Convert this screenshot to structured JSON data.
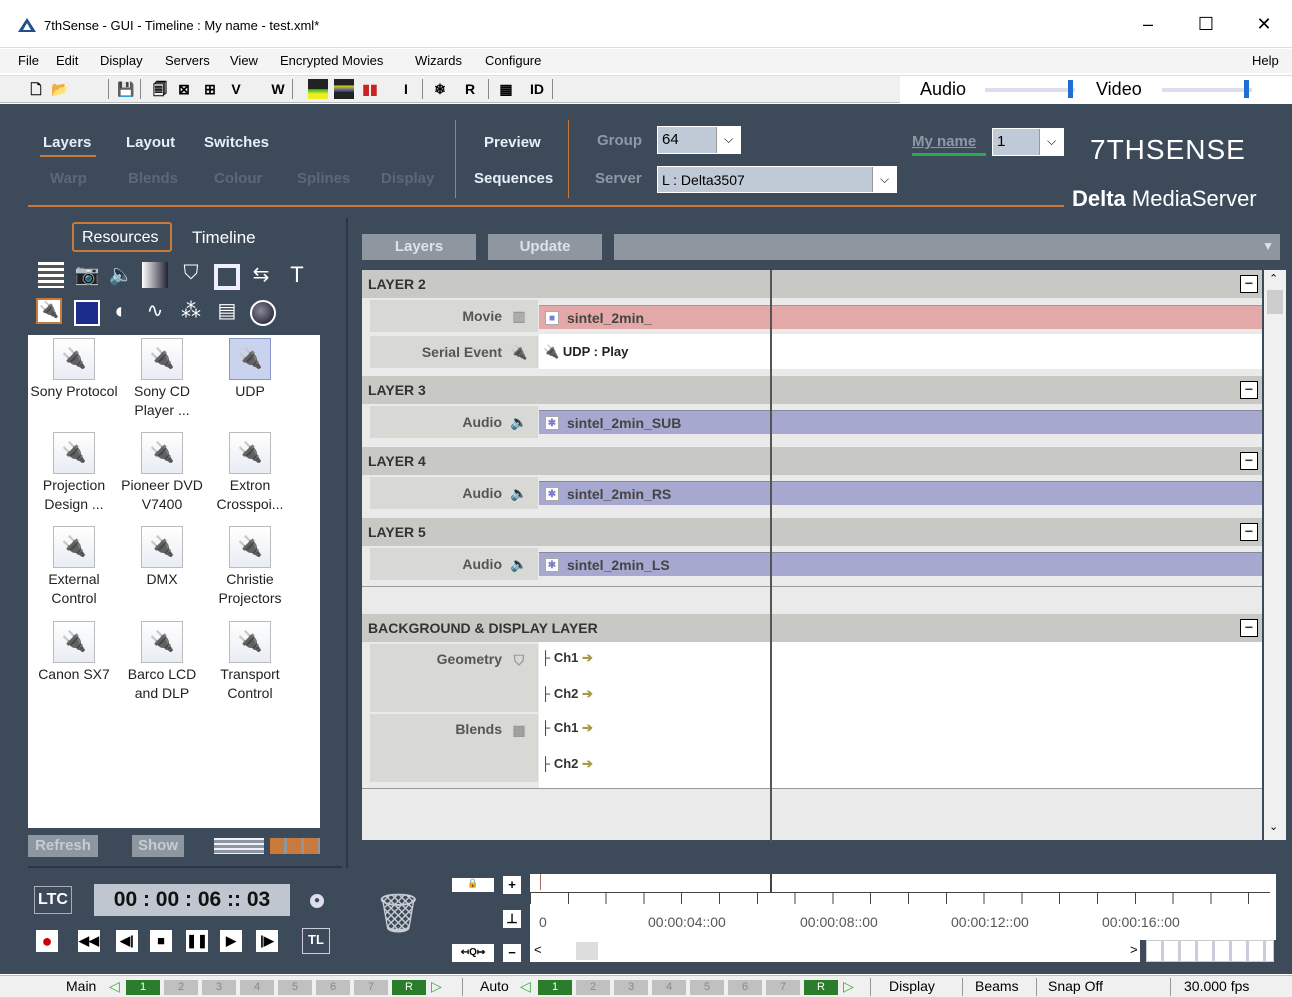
{
  "window": {
    "title": "7thSense -   GUI  - Timeline : My name  - test.xml*",
    "minimize": "–",
    "maximize": "☐",
    "close": "✕"
  },
  "menu": {
    "items": [
      "File",
      "Edit",
      "Display",
      "Servers",
      "View",
      "Encrypted Movies",
      "Wizards",
      "Configure"
    ],
    "help": "Help"
  },
  "toolbar": {
    "v": "V",
    "w": "W",
    "i": "I",
    "r": "R",
    "id": "ID",
    "audio": "Audio",
    "video": "Video"
  },
  "header": {
    "tabs_row1": [
      "Layers",
      "Layout",
      "Switches"
    ],
    "tabs_row2": [
      "Warp",
      "Blends",
      "Colour",
      "Splines",
      "Display"
    ],
    "preview": "Preview",
    "sequences": "Sequences",
    "group_label": "Group",
    "group_value": "64",
    "server_label": "Server",
    "server_value": "L : Delta3507",
    "name_label": "My name",
    "name_value": "1",
    "brand": "7THSENSE",
    "brand_sub_bold": "Delta",
    "brand_sub": " MediaServer"
  },
  "left": {
    "tab_resources": "Resources",
    "tab_timeline": "Timeline",
    "devices": [
      "Sony Protocol",
      "Sony CD Player ...",
      "UDP",
      "Projection Design ...",
      "Pioneer DVD V7400",
      "Extron Crosspoi...",
      "External Control",
      "DMX",
      "Christie Projectors",
      "Canon SX7",
      "Barco LCD and DLP",
      "Transport Control"
    ],
    "refresh": "Refresh",
    "show": "Show"
  },
  "timeline": {
    "btn_layers": "Layers",
    "btn_update": "Update",
    "layers": [
      {
        "name": "LAYER 2",
        "tracks": [
          {
            "label": "Movie",
            "clip": "sintel_2min_",
            "kind": "red"
          },
          {
            "label": "Serial Event",
            "clip": "UDP : Play",
            "kind": "white"
          }
        ]
      },
      {
        "name": "LAYER 3",
        "tracks": [
          {
            "label": "Audio",
            "clip": "sintel_2min_SUB",
            "kind": "blue"
          }
        ]
      },
      {
        "name": "LAYER 4",
        "tracks": [
          {
            "label": "Audio",
            "clip": "sintel_2min_RS",
            "kind": "blue"
          }
        ]
      },
      {
        "name": "LAYER 5",
        "tracks": [
          {
            "label": "Audio",
            "clip": "sintel_2min_LS",
            "kind": "blue"
          }
        ]
      }
    ],
    "bg_layer": "BACKGROUND & DISPLAY LAYER",
    "geometry": "Geometry",
    "blends": "Blends",
    "ch1": "Ch1",
    "ch2": "Ch2",
    "ruler": [
      "0",
      "00:00:04::00",
      "00:00:08::00",
      "00:00:12::00",
      "00:00:16::00"
    ]
  },
  "transport": {
    "ltc": "LTC",
    "timecode": "00 : 00 : 06 :: 03",
    "tl": "TL"
  },
  "status": {
    "main": "Main",
    "auto": "Auto",
    "pages": [
      "1",
      "2",
      "3",
      "4",
      "5",
      "6",
      "7",
      "R"
    ],
    "display": "Display",
    "beams": "Beams",
    "snap": "Snap Off",
    "fps": "30.000 fps"
  }
}
